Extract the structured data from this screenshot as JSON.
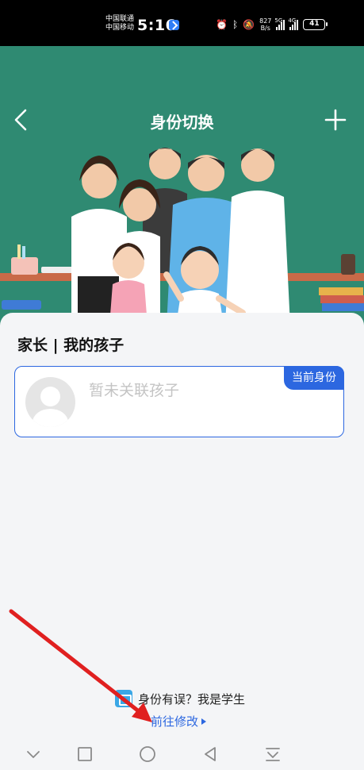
{
  "status_bar": {
    "carrier_1": "中国联通",
    "carrier_2": "中国移动",
    "time": "5:16",
    "net_speed_value": "827",
    "net_speed_unit": "B/s",
    "signal_1_tag": "5G",
    "signal_2_tag": "4G",
    "battery": "41"
  },
  "header": {
    "title": "身份切换"
  },
  "section": {
    "title": "家长 | 我的孩子"
  },
  "child_card": {
    "empty_text": "暂未关联孩子",
    "current_badge": "当前身份"
  },
  "footer": {
    "wrong_identity_text": "身份有误？我是学生",
    "goto_link": "前往修改"
  },
  "colors": {
    "accent": "#2c67e0",
    "hero_bg": "#2f8a72",
    "annotation_arrow": "#e02020"
  },
  "icons": {
    "back": "chevron-left-icon",
    "add": "plus-icon",
    "avatar": "default-avatar-icon",
    "student": "student-card-icon",
    "link_arrow": "triangle-right-icon"
  }
}
